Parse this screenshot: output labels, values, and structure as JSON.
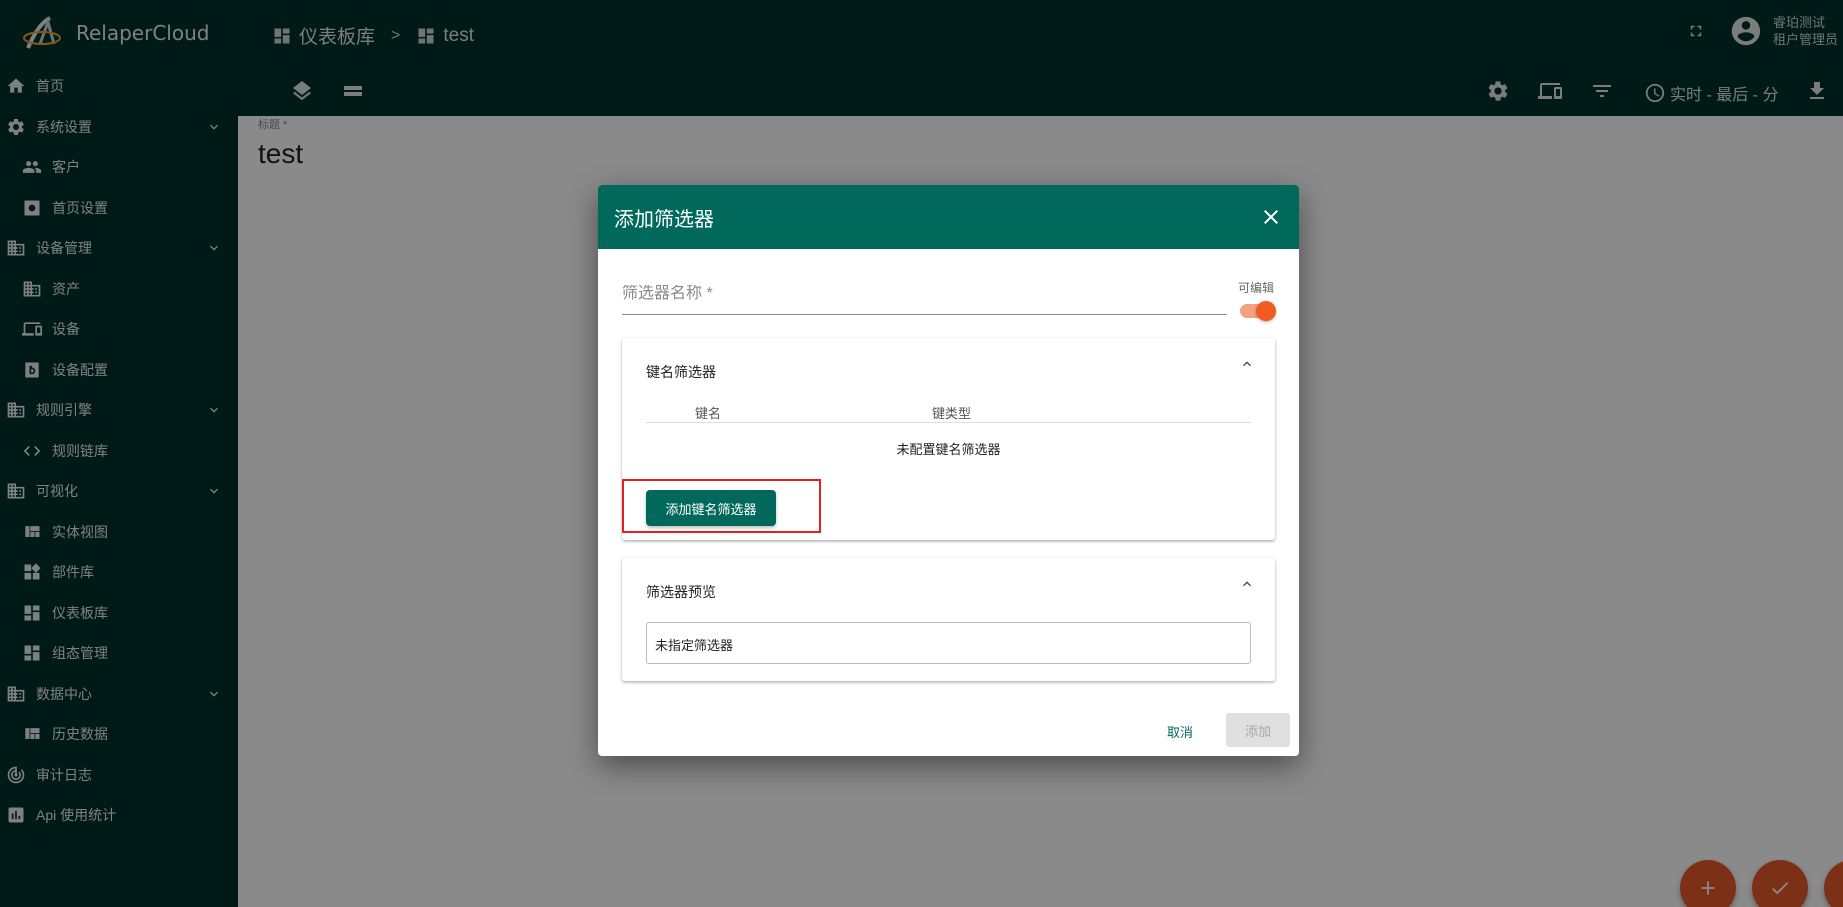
{
  "app": {
    "name": "RelaperCloud"
  },
  "breadcrumb": [
    {
      "label": "仪表板库",
      "icon": "dashboard-icon"
    },
    {
      "label": "test",
      "icon": "dashboard-icon"
    }
  ],
  "breadcrumb_separator": ">",
  "user": {
    "name": "睿珀测试",
    "role": "租户管理员"
  },
  "toolbar": {
    "timewindow_label": "实时 - 最后 - 分"
  },
  "sidebar": {
    "items": [
      {
        "label": "首页",
        "icon": "home-icon",
        "level": 1
      },
      {
        "label": "系统设置",
        "icon": "gear-icon",
        "level": 1,
        "expandable": true
      },
      {
        "label": "客户",
        "icon": "people-icon",
        "level": 2
      },
      {
        "label": "首页设置",
        "icon": "settings-box-icon",
        "level": 2
      },
      {
        "label": "设备管理",
        "icon": "domain-icon",
        "level": 1,
        "expandable": true
      },
      {
        "label": "资产",
        "icon": "domain-icon",
        "level": 2
      },
      {
        "label": "设备",
        "icon": "devices-icon",
        "level": 2
      },
      {
        "label": "设备配置",
        "icon": "device-profile-icon",
        "level": 2
      },
      {
        "label": "规则引擎",
        "icon": "domain-icon",
        "level": 1,
        "expandable": true
      },
      {
        "label": "规则链库",
        "icon": "code-icon",
        "level": 2
      },
      {
        "label": "可视化",
        "icon": "domain-icon",
        "level": 1,
        "expandable": true
      },
      {
        "label": "实体视图",
        "icon": "view-quilt-icon",
        "level": 2
      },
      {
        "label": "部件库",
        "icon": "widgets-icon",
        "level": 2
      },
      {
        "label": "仪表板库",
        "icon": "dashboard-icon",
        "level": 2
      },
      {
        "label": "组态管理",
        "icon": "dashboard-icon",
        "level": 2
      },
      {
        "label": "数据中心",
        "icon": "domain-icon",
        "level": 1,
        "expandable": true
      },
      {
        "label": "历史数据",
        "icon": "view-quilt-icon",
        "level": 2
      },
      {
        "label": "审计日志",
        "icon": "track-changes-icon",
        "level": 1
      },
      {
        "label": "Api 使用统计",
        "icon": "chart-icon",
        "level": 1
      }
    ]
  },
  "content": {
    "title_label": "标题 *",
    "title_value": "test"
  },
  "dialog": {
    "title": "添加筛选器",
    "name_placeholder": "筛选器名称 *",
    "editable_label": "可编辑",
    "editable_on": true,
    "key_filters": {
      "title": "键名筛选器",
      "columns": [
        "键名",
        "键类型"
      ],
      "empty_message": "未配置键名筛选器",
      "add_button": "添加键名筛选器"
    },
    "preview": {
      "title": "筛选器预览",
      "value": "未指定筛选器"
    },
    "cancel_button": "取消",
    "add_button": "添加"
  },
  "colors": {
    "primary_dark": "#00312c",
    "primary": "#00695c",
    "accent": "#f15a22",
    "highlight": "#e32020"
  }
}
